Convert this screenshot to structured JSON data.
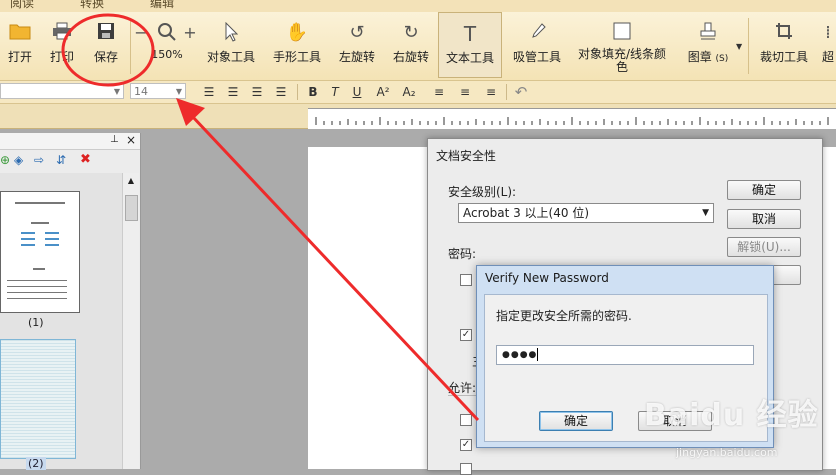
{
  "tabs": [
    "阅读",
    "转换",
    "编辑"
  ],
  "toolbar": {
    "open": "打开",
    "print": "打印",
    "save": "保存",
    "zoom": "150%",
    "object_tool": "对象工具",
    "hand_tool": "手形工具",
    "rotate_left": "左旋转",
    "rotate_right": "右旋转",
    "text_tool": "文本工具",
    "eyedropper": "吸管工具",
    "fill_stroke_1": "对象填充/线条颜",
    "fill_stroke_2": "色",
    "stamp": "图章",
    "stamp_shortcut": "(S)",
    "crop": "裁切工具",
    "more": "超"
  },
  "formatbar": {
    "font_size": "14",
    "bold": "B",
    "italic": "T",
    "underline": "U",
    "superscript": "A²",
    "subscript": "A₂"
  },
  "thumbnails": [
    "(1)",
    "(2)"
  ],
  "security_dialog": {
    "title": "文档安全性",
    "level_label": "安全级别(L):",
    "level_value": "Acrobat 3 以上(40 位)",
    "ok": "确定",
    "cancel": "取消",
    "unlock": "解锁(U)...",
    "password_label": "密码:",
    "allow_label": "允许:"
  },
  "password_dialog": {
    "title": "Verify New Password",
    "message": "指定更改安全所需的密码.",
    "password_value": "●●●●",
    "ok": "确定",
    "cancel": "取消"
  },
  "watermark": {
    "brand": "Baidu 经验",
    "url": "jingyan.baidu.com"
  },
  "colors": {
    "annotation_red": "#ee2b2b",
    "toolbar_bg": "#f6e8c2"
  }
}
